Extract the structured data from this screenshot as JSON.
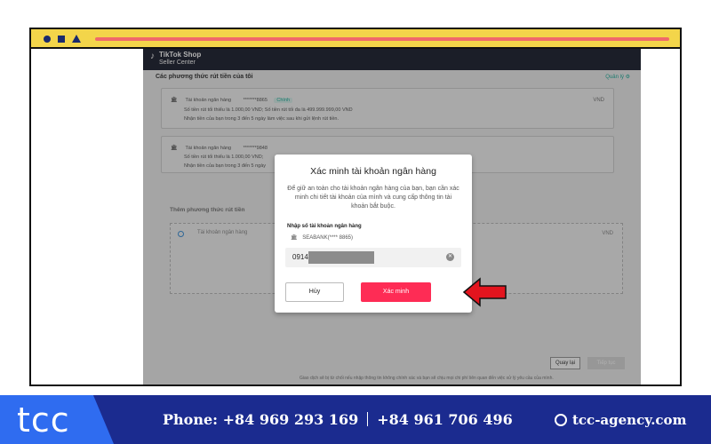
{
  "app": {
    "logo_title": "TikTok Shop",
    "logo_subtitle": "Seller Center",
    "section_title": "Các phương thức rút tiền của tôi",
    "manage_link": "Quản lý ⚙",
    "currency": "VND",
    "accounts": [
      {
        "label": "Tài khoản ngân hàng",
        "number": "*******8865",
        "badge": "Chính",
        "limits": "Số tiền rút tối thiểu là 1.000,00 VND; Số tiền rút tối đa là 499.999.999,00 VND",
        "timing": "Nhận tiền của bạn trong 3 đến 5 ngày làm việc sau khi gửi lệnh rút tiền."
      },
      {
        "label": "Tài khoản ngân hàng",
        "number": "*******9848",
        "limits": "Số tiền rút tối thiểu là 1.000,00 VND;",
        "timing": "Nhận tiền của bạn trong 3 đến 5 ngày"
      }
    ],
    "add_title": "Thêm phương thức rút tiền",
    "add_option": "Tài khoản ngân hàng",
    "back_button": "Quay lại",
    "next_button": "Tiếp tục",
    "footer_note": "Giao dịch sẽ bị từ chối nếu nhập thông tin không chính xác và bạn sẽ chịu mọi chi phí liên quan đến việc xử lý yêu cầu của mình."
  },
  "dialog": {
    "title": "Xác minh tài khoản ngân hàng",
    "description": "Để giữ an toàn cho tài khoản ngân hàng của bạn, bạn cần xác minh chi tiết tài khoản của mình và cung cấp thông tin tài khoản bắt buộc.",
    "input_label": "Nhập số tài khoản ngân hàng",
    "bank_line": "SEABANK(**** 8865)",
    "input_value": "0914",
    "cancel_button": "Hủy",
    "confirm_button": "Xác minh"
  },
  "banner": {
    "logo": "tcc",
    "phone_1": "Phone: +84 969 293 169",
    "phone_2": "+84 961 706 496",
    "website": "tcc-agency.com"
  },
  "colors": {
    "frame_bar": "#f3d54a",
    "frame_line": "#f06a6a",
    "confirm": "#fe2c55",
    "banner": "#1b2b8f",
    "banner_accent": "#2f6cf0",
    "arrow": "#e3141e"
  },
  "icons": [
    "bank-icon",
    "clear-icon",
    "globe-icon",
    "red-arrow-icon",
    "tiktok-note-icon"
  ]
}
